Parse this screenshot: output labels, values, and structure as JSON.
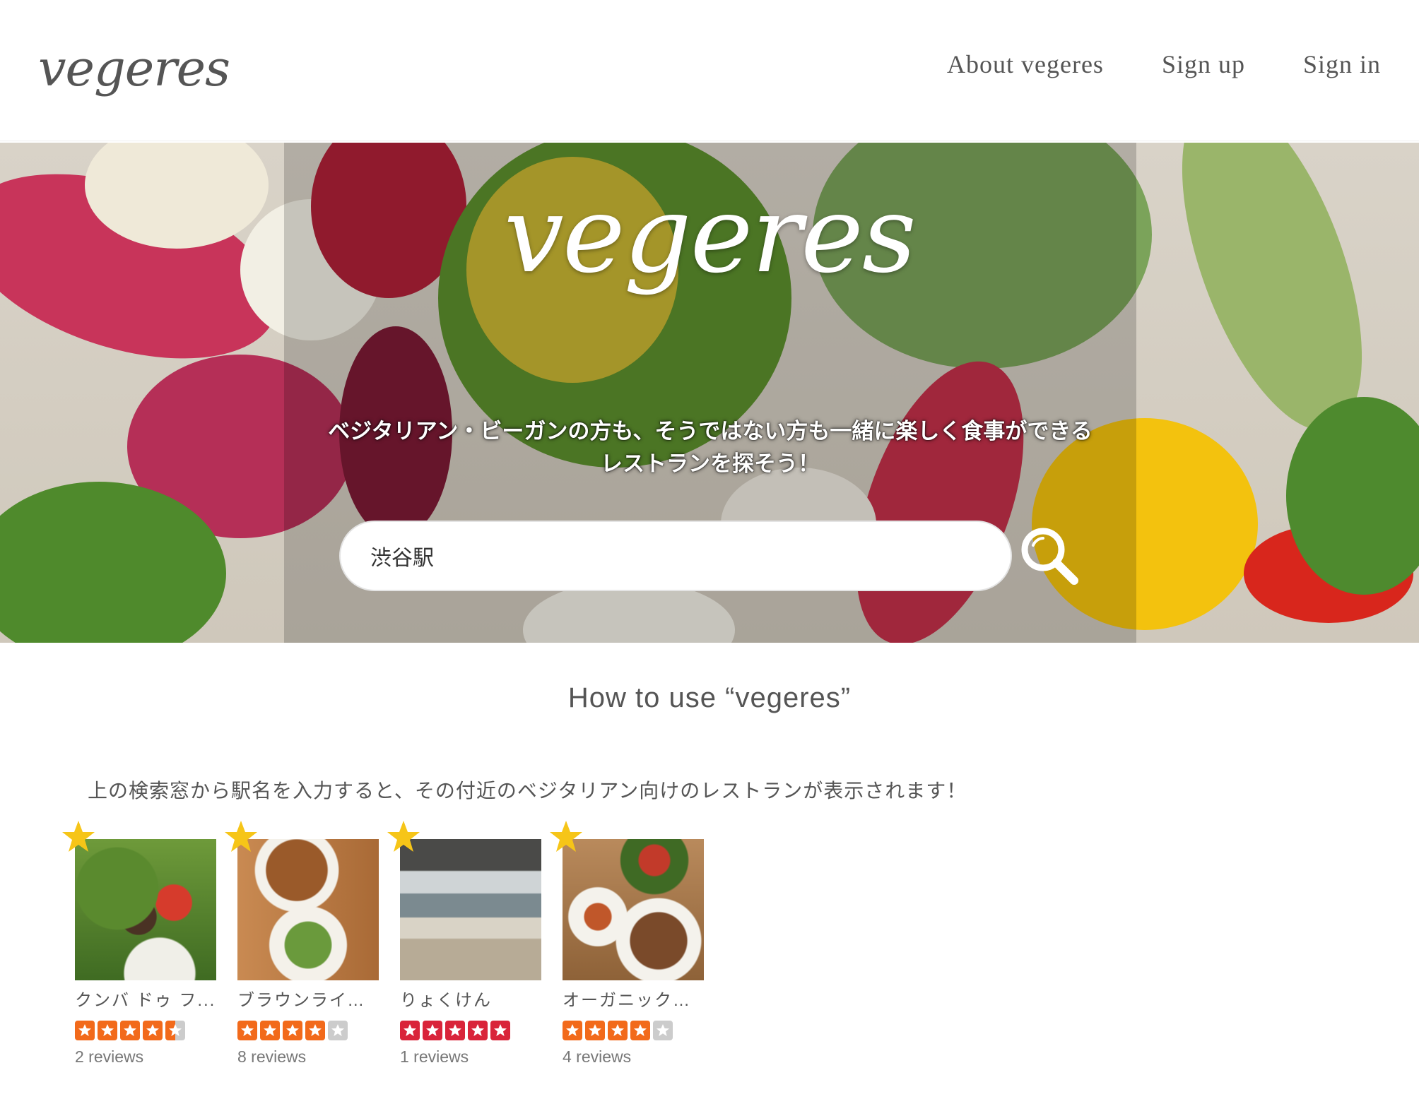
{
  "header": {
    "logo": "vegeres",
    "nav": [
      {
        "label": "About vegeres"
      },
      {
        "label": "Sign up"
      },
      {
        "label": "Sign in"
      }
    ]
  },
  "hero": {
    "title": "vegeres",
    "tagline_line1": "ベジタリアン・ビーガンの方も、そうではない方も一緒に楽しく食事ができる",
    "tagline_line2": "レストランを探そう！",
    "search_value": "渋谷駅"
  },
  "section": {
    "title": "How to use “vegeres”",
    "instruction": "上の検索窓から駅名を入力すると、その付近のベジタリアン向けのレストランが表示されます！"
  },
  "restaurants": [
    {
      "name": "クンバ ドゥ フ...",
      "rating": 4.5,
      "reviews": "2 reviews",
      "star_color": "#f26a1b"
    },
    {
      "name": "ブラウンライス ...",
      "rating": 4,
      "reviews": "8 reviews",
      "star_color": "#f26a1b"
    },
    {
      "name": "りょくけん",
      "rating": 5,
      "reviews": "1 reviews",
      "star_color": "#d9243a"
    },
    {
      "name": "オーガニックレ...",
      "rating": 4,
      "reviews": "4 reviews",
      "star_color": "#f26a1b"
    }
  ],
  "colors": {
    "text": "#555555",
    "fav_star": "#f6c518",
    "empty_star": "#cccccc"
  }
}
